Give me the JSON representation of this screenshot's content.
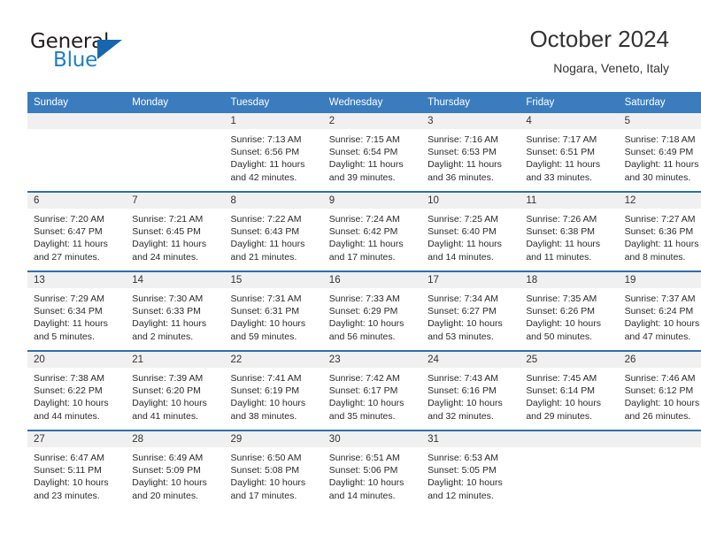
{
  "logo": {
    "word1": "General",
    "word2": "Blue",
    "triangle_color": "#1667ad",
    "blue_color": "#1c7fc4"
  },
  "header": {
    "title": "October 2024",
    "subtitle": "Nogara, Veneto, Italy"
  },
  "theme": {
    "header_bg": "#3a7cbe",
    "row_border": "#2f6fae",
    "daynum_bg": "#f0f0f0"
  },
  "weekdays": [
    "Sunday",
    "Monday",
    "Tuesday",
    "Wednesday",
    "Thursday",
    "Friday",
    "Saturday"
  ],
  "weeks": [
    [
      {
        "day": "",
        "empty": true
      },
      {
        "day": "",
        "empty": true
      },
      {
        "day": "1",
        "sunrise": "Sunrise: 7:13 AM",
        "sunset": "Sunset: 6:56 PM",
        "daylight1": "Daylight: 11 hours",
        "daylight2": "and 42 minutes."
      },
      {
        "day": "2",
        "sunrise": "Sunrise: 7:15 AM",
        "sunset": "Sunset: 6:54 PM",
        "daylight1": "Daylight: 11 hours",
        "daylight2": "and 39 minutes."
      },
      {
        "day": "3",
        "sunrise": "Sunrise: 7:16 AM",
        "sunset": "Sunset: 6:53 PM",
        "daylight1": "Daylight: 11 hours",
        "daylight2": "and 36 minutes."
      },
      {
        "day": "4",
        "sunrise": "Sunrise: 7:17 AM",
        "sunset": "Sunset: 6:51 PM",
        "daylight1": "Daylight: 11 hours",
        "daylight2": "and 33 minutes."
      },
      {
        "day": "5",
        "sunrise": "Sunrise: 7:18 AM",
        "sunset": "Sunset: 6:49 PM",
        "daylight1": "Daylight: 11 hours",
        "daylight2": "and 30 minutes."
      }
    ],
    [
      {
        "day": "6",
        "sunrise": "Sunrise: 7:20 AM",
        "sunset": "Sunset: 6:47 PM",
        "daylight1": "Daylight: 11 hours",
        "daylight2": "and 27 minutes."
      },
      {
        "day": "7",
        "sunrise": "Sunrise: 7:21 AM",
        "sunset": "Sunset: 6:45 PM",
        "daylight1": "Daylight: 11 hours",
        "daylight2": "and 24 minutes."
      },
      {
        "day": "8",
        "sunrise": "Sunrise: 7:22 AM",
        "sunset": "Sunset: 6:43 PM",
        "daylight1": "Daylight: 11 hours",
        "daylight2": "and 21 minutes."
      },
      {
        "day": "9",
        "sunrise": "Sunrise: 7:24 AM",
        "sunset": "Sunset: 6:42 PM",
        "daylight1": "Daylight: 11 hours",
        "daylight2": "and 17 minutes."
      },
      {
        "day": "10",
        "sunrise": "Sunrise: 7:25 AM",
        "sunset": "Sunset: 6:40 PM",
        "daylight1": "Daylight: 11 hours",
        "daylight2": "and 14 minutes."
      },
      {
        "day": "11",
        "sunrise": "Sunrise: 7:26 AM",
        "sunset": "Sunset: 6:38 PM",
        "daylight1": "Daylight: 11 hours",
        "daylight2": "and 11 minutes."
      },
      {
        "day": "12",
        "sunrise": "Sunrise: 7:27 AM",
        "sunset": "Sunset: 6:36 PM",
        "daylight1": "Daylight: 11 hours",
        "daylight2": "and 8 minutes."
      }
    ],
    [
      {
        "day": "13",
        "sunrise": "Sunrise: 7:29 AM",
        "sunset": "Sunset: 6:34 PM",
        "daylight1": "Daylight: 11 hours",
        "daylight2": "and 5 minutes."
      },
      {
        "day": "14",
        "sunrise": "Sunrise: 7:30 AM",
        "sunset": "Sunset: 6:33 PM",
        "daylight1": "Daylight: 11 hours",
        "daylight2": "and 2 minutes."
      },
      {
        "day": "15",
        "sunrise": "Sunrise: 7:31 AM",
        "sunset": "Sunset: 6:31 PM",
        "daylight1": "Daylight: 10 hours",
        "daylight2": "and 59 minutes."
      },
      {
        "day": "16",
        "sunrise": "Sunrise: 7:33 AM",
        "sunset": "Sunset: 6:29 PM",
        "daylight1": "Daylight: 10 hours",
        "daylight2": "and 56 minutes."
      },
      {
        "day": "17",
        "sunrise": "Sunrise: 7:34 AM",
        "sunset": "Sunset: 6:27 PM",
        "daylight1": "Daylight: 10 hours",
        "daylight2": "and 53 minutes."
      },
      {
        "day": "18",
        "sunrise": "Sunrise: 7:35 AM",
        "sunset": "Sunset: 6:26 PM",
        "daylight1": "Daylight: 10 hours",
        "daylight2": "and 50 minutes."
      },
      {
        "day": "19",
        "sunrise": "Sunrise: 7:37 AM",
        "sunset": "Sunset: 6:24 PM",
        "daylight1": "Daylight: 10 hours",
        "daylight2": "and 47 minutes."
      }
    ],
    [
      {
        "day": "20",
        "sunrise": "Sunrise: 7:38 AM",
        "sunset": "Sunset: 6:22 PM",
        "daylight1": "Daylight: 10 hours",
        "daylight2": "and 44 minutes."
      },
      {
        "day": "21",
        "sunrise": "Sunrise: 7:39 AM",
        "sunset": "Sunset: 6:20 PM",
        "daylight1": "Daylight: 10 hours",
        "daylight2": "and 41 minutes."
      },
      {
        "day": "22",
        "sunrise": "Sunrise: 7:41 AM",
        "sunset": "Sunset: 6:19 PM",
        "daylight1": "Daylight: 10 hours",
        "daylight2": "and 38 minutes."
      },
      {
        "day": "23",
        "sunrise": "Sunrise: 7:42 AM",
        "sunset": "Sunset: 6:17 PM",
        "daylight1": "Daylight: 10 hours",
        "daylight2": "and 35 minutes."
      },
      {
        "day": "24",
        "sunrise": "Sunrise: 7:43 AM",
        "sunset": "Sunset: 6:16 PM",
        "daylight1": "Daylight: 10 hours",
        "daylight2": "and 32 minutes."
      },
      {
        "day": "25",
        "sunrise": "Sunrise: 7:45 AM",
        "sunset": "Sunset: 6:14 PM",
        "daylight1": "Daylight: 10 hours",
        "daylight2": "and 29 minutes."
      },
      {
        "day": "26",
        "sunrise": "Sunrise: 7:46 AM",
        "sunset": "Sunset: 6:12 PM",
        "daylight1": "Daylight: 10 hours",
        "daylight2": "and 26 minutes."
      }
    ],
    [
      {
        "day": "27",
        "sunrise": "Sunrise: 6:47 AM",
        "sunset": "Sunset: 5:11 PM",
        "daylight1": "Daylight: 10 hours",
        "daylight2": "and 23 minutes."
      },
      {
        "day": "28",
        "sunrise": "Sunrise: 6:49 AM",
        "sunset": "Sunset: 5:09 PM",
        "daylight1": "Daylight: 10 hours",
        "daylight2": "and 20 minutes."
      },
      {
        "day": "29",
        "sunrise": "Sunrise: 6:50 AM",
        "sunset": "Sunset: 5:08 PM",
        "daylight1": "Daylight: 10 hours",
        "daylight2": "and 17 minutes."
      },
      {
        "day": "30",
        "sunrise": "Sunrise: 6:51 AM",
        "sunset": "Sunset: 5:06 PM",
        "daylight1": "Daylight: 10 hours",
        "daylight2": "and 14 minutes."
      },
      {
        "day": "31",
        "sunrise": "Sunrise: 6:53 AM",
        "sunset": "Sunset: 5:05 PM",
        "daylight1": "Daylight: 10 hours",
        "daylight2": "and 12 minutes."
      },
      {
        "day": "",
        "empty": true
      },
      {
        "day": "",
        "empty": true
      }
    ]
  ]
}
